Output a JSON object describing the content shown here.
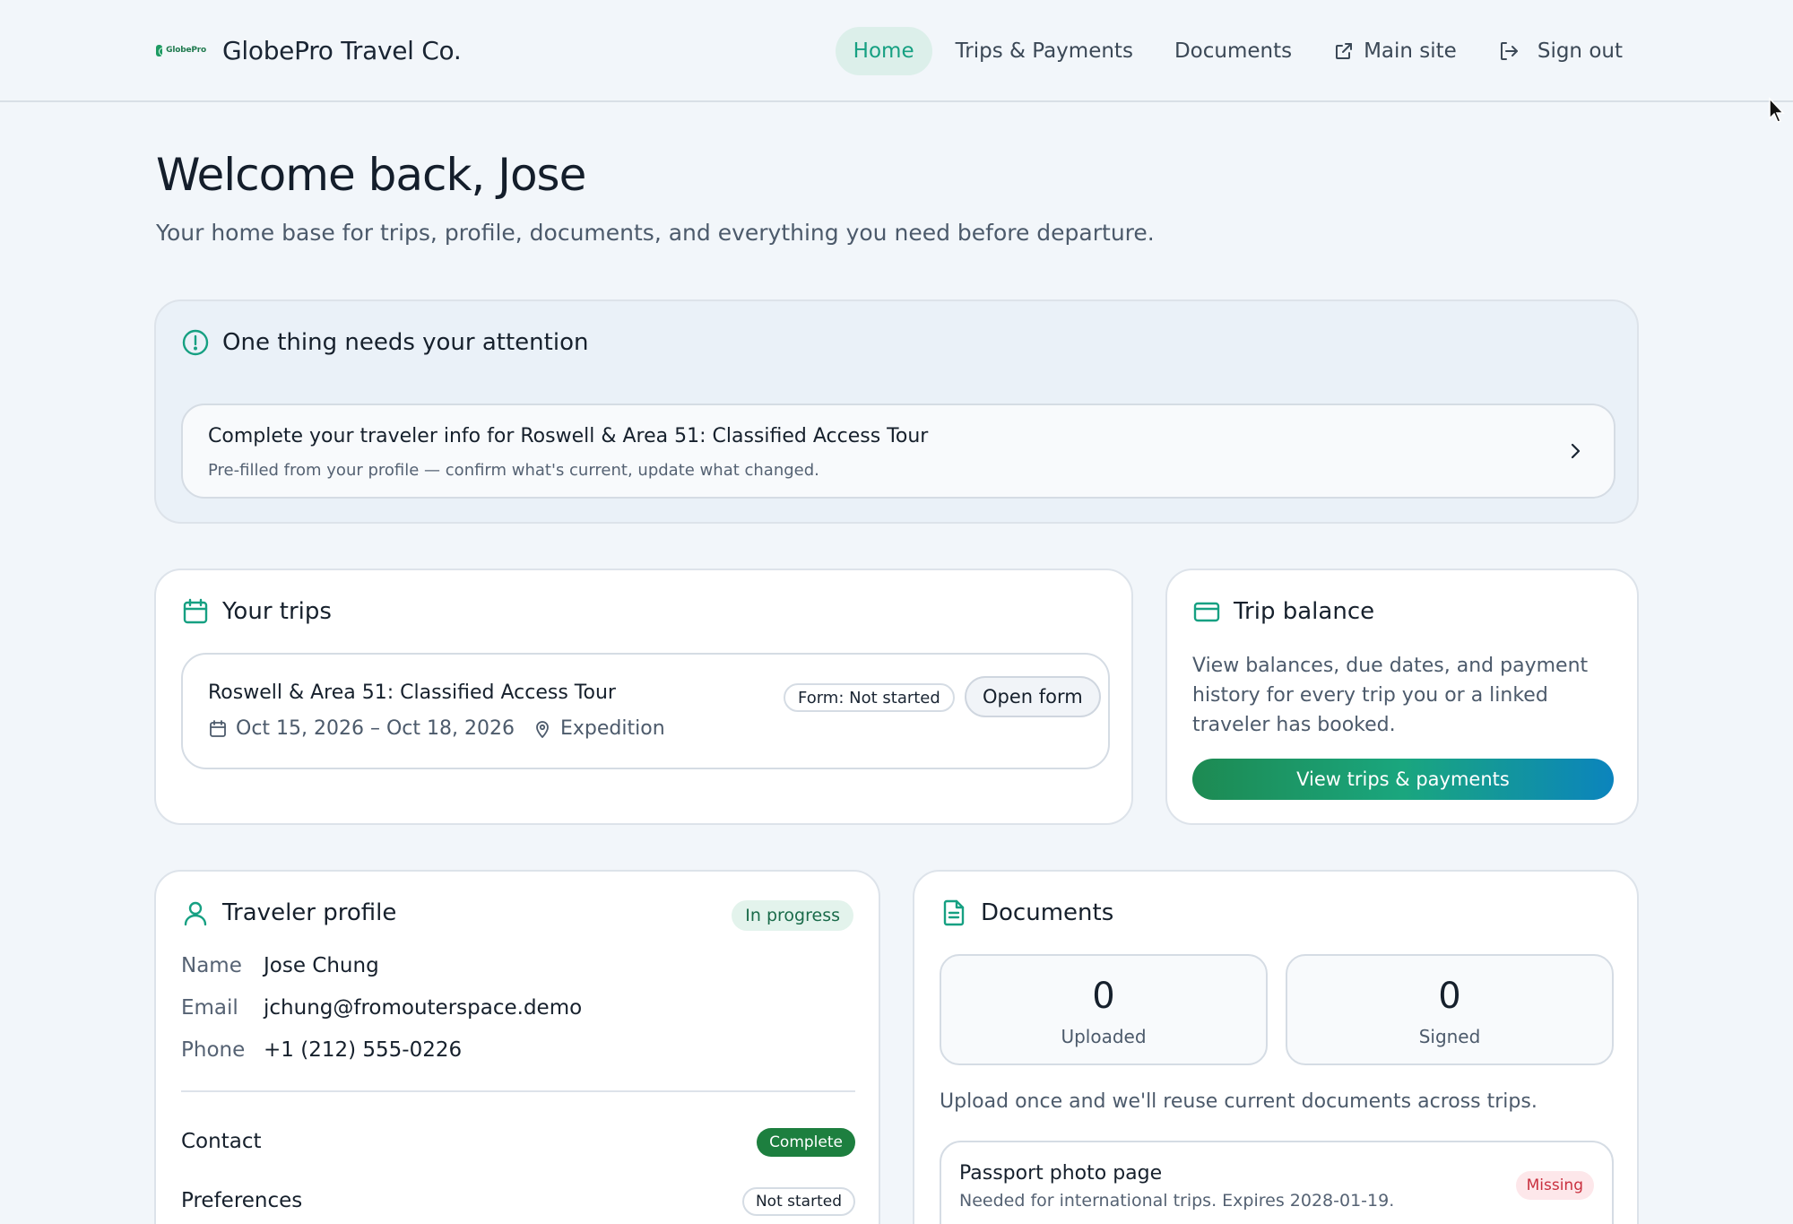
{
  "header": {
    "logo_text": "GlobePro",
    "brand_name": "GlobePro Travel Co.",
    "nav": {
      "home": "Home",
      "trips_payments": "Trips & Payments",
      "documents": "Documents",
      "main_site": "Main site",
      "sign_out": "Sign out"
    }
  },
  "hero": {
    "title": "Welcome back, Jose",
    "subtitle": "Your home base for trips, profile, documents, and everything you need before departure."
  },
  "attention": {
    "title": "One thing needs your attention",
    "item_title": "Complete your traveler info for Roswell & Area 51: Classified Access Tour",
    "item_subtitle": "Pre-filled from your profile — confirm what's current, update what changed."
  },
  "trips": {
    "title": "Your trips",
    "items": [
      {
        "name": "Roswell & Area 51: Classified Access Tour",
        "dates": "Oct 15, 2026 – Oct 18, 2026",
        "type": "Expedition",
        "form_status": "Form: Not started",
        "open_label": "Open form"
      }
    ]
  },
  "balance": {
    "title": "Trip balance",
    "description": "View balances, due dates, and payment history for every trip you or a linked traveler has booked.",
    "button": "View trips & payments"
  },
  "profile": {
    "title": "Traveler profile",
    "status": "In progress",
    "fields": [
      {
        "label": "Name",
        "value": "Jose Chung"
      },
      {
        "label": "Email",
        "value": "jchung@fromouterspace.demo"
      },
      {
        "label": "Phone",
        "value": "+1 (212) 555-0226"
      }
    ],
    "sections": [
      {
        "label": "Contact",
        "status": "Complete"
      },
      {
        "label": "Preferences",
        "status": "Not started"
      }
    ]
  },
  "documents": {
    "title": "Documents",
    "uploaded_count": "0",
    "uploaded_label": "Uploaded",
    "signed_count": "0",
    "signed_label": "Signed",
    "note": "Upload once and we'll reuse current documents across trips.",
    "items": [
      {
        "title": "Passport photo page",
        "subtitle": "Needed for international trips. Expires 2028-01-19.",
        "status": "Missing"
      }
    ]
  },
  "colors": {
    "accent": "#16a082",
    "complete": "#1d7f3f",
    "missing": "#c9303f"
  }
}
